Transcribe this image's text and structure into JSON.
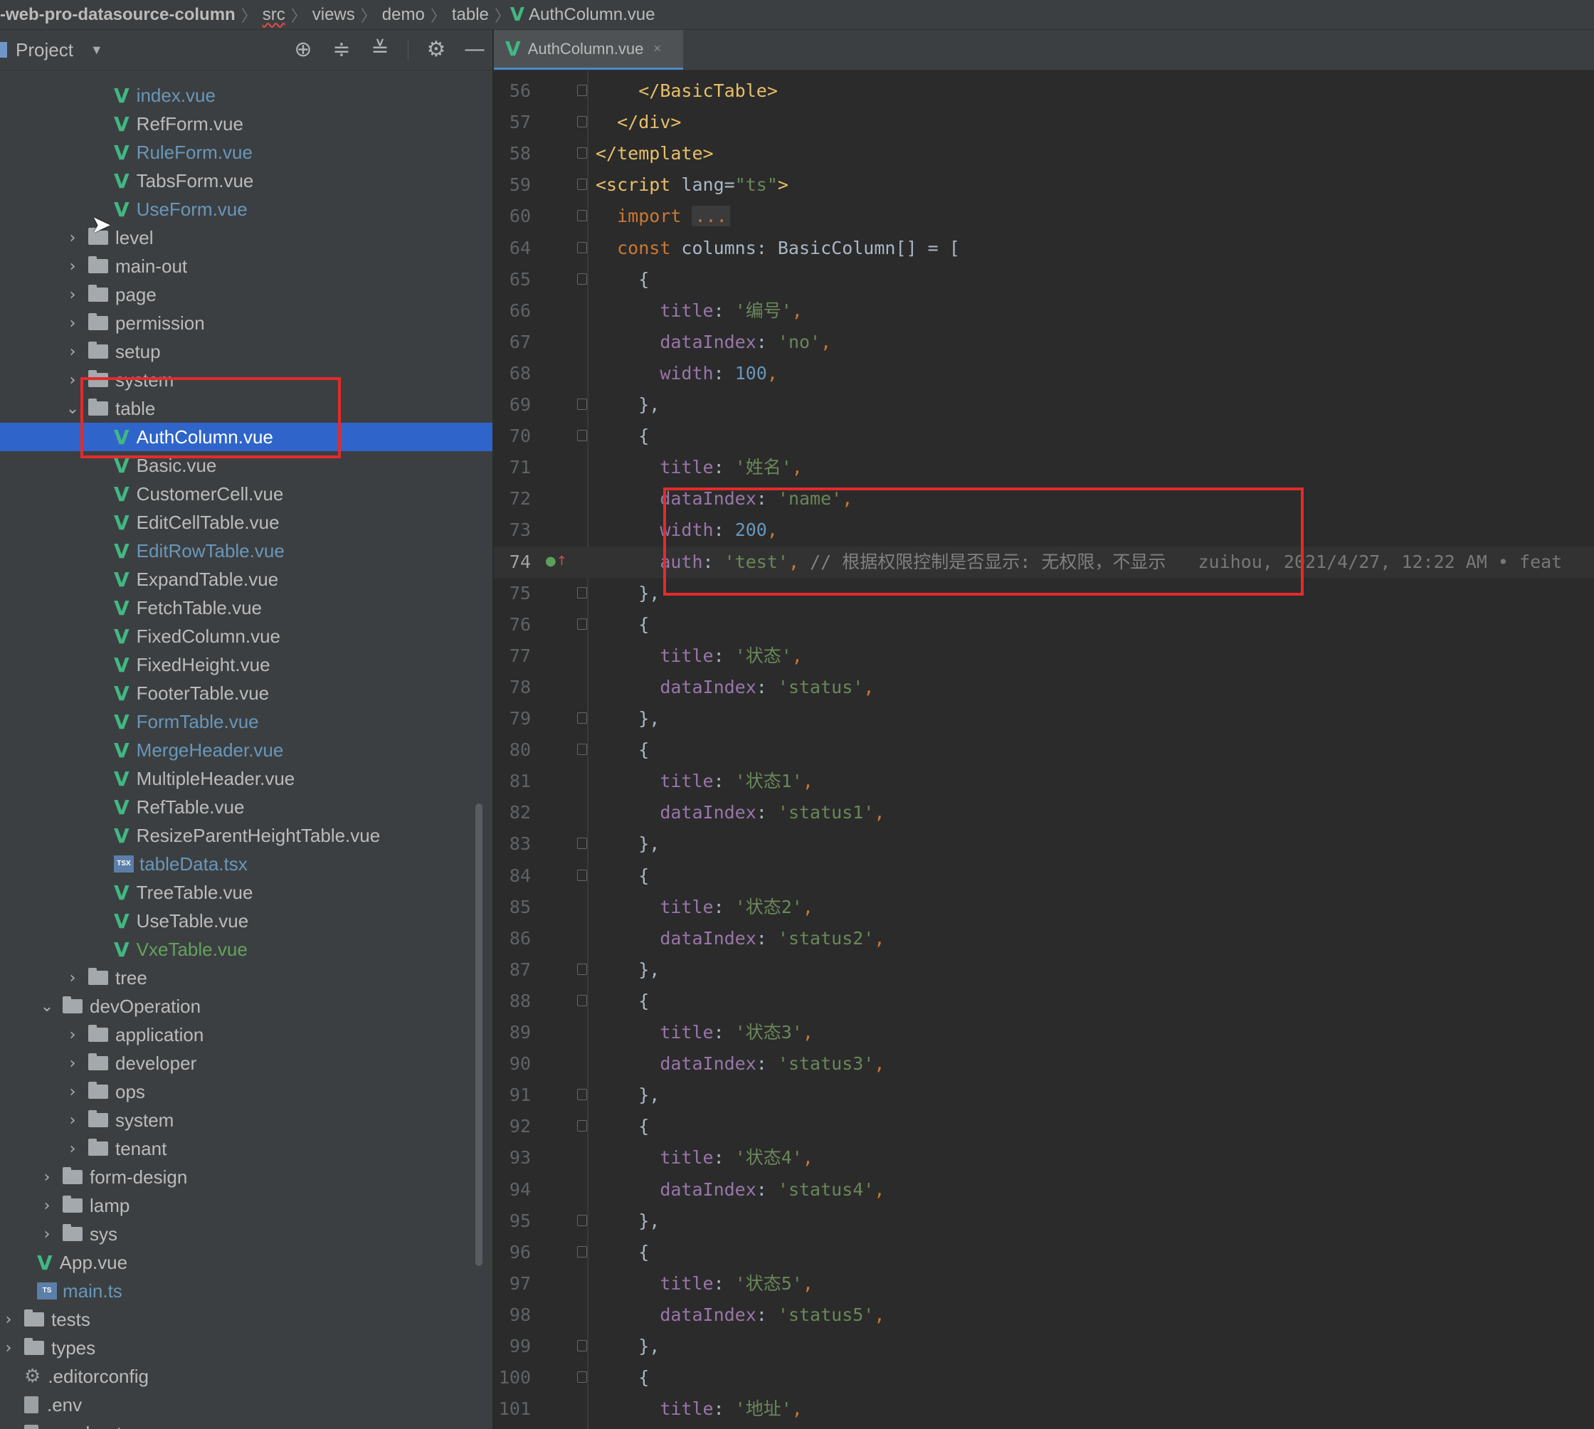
{
  "breadcrumb": {
    "items": [
      "-web-pro-datasource-column",
      "src",
      "views",
      "demo",
      "table",
      "AuthColumn.vue"
    ]
  },
  "project_panel": {
    "title": "Project",
    "icons": [
      "locate-icon",
      "expand-all-icon",
      "collapse-all-icon",
      "gear-icon",
      "minimize-icon"
    ]
  },
  "tree": [
    {
      "label": "index.vue",
      "type": "vue",
      "color": "blue",
      "indent": 6
    },
    {
      "label": "RefForm.vue",
      "type": "vue",
      "color": "default",
      "indent": 6
    },
    {
      "label": "RuleForm.vue",
      "type": "vue",
      "color": "blue",
      "indent": 6
    },
    {
      "label": "TabsForm.vue",
      "type": "vue",
      "color": "default",
      "indent": 6
    },
    {
      "label": "UseForm.vue",
      "type": "vue",
      "color": "blue",
      "indent": 6
    },
    {
      "label": "level",
      "type": "folder",
      "state": "collapsed",
      "indent": 5
    },
    {
      "label": "main-out",
      "type": "folder",
      "state": "collapsed",
      "indent": 5
    },
    {
      "label": "page",
      "type": "folder",
      "state": "collapsed",
      "indent": 5
    },
    {
      "label": "permission",
      "type": "folder",
      "state": "collapsed",
      "indent": 5
    },
    {
      "label": "setup",
      "type": "folder",
      "state": "collapsed",
      "indent": 5
    },
    {
      "label": "system",
      "type": "folder",
      "state": "collapsed",
      "indent": 5
    },
    {
      "label": "table",
      "type": "folder",
      "state": "expanded",
      "indent": 5
    },
    {
      "label": "AuthColumn.vue",
      "type": "vue",
      "color": "white",
      "indent": 6,
      "selected": true
    },
    {
      "label": "Basic.vue",
      "type": "vue",
      "color": "default",
      "indent": 6
    },
    {
      "label": "CustomerCell.vue",
      "type": "vue",
      "color": "default",
      "indent": 6
    },
    {
      "label": "EditCellTable.vue",
      "type": "vue",
      "color": "default",
      "indent": 6
    },
    {
      "label": "EditRowTable.vue",
      "type": "vue",
      "color": "blue",
      "indent": 6
    },
    {
      "label": "ExpandTable.vue",
      "type": "vue",
      "color": "default",
      "indent": 6
    },
    {
      "label": "FetchTable.vue",
      "type": "vue",
      "color": "default",
      "indent": 6
    },
    {
      "label": "FixedColumn.vue",
      "type": "vue",
      "color": "default",
      "indent": 6
    },
    {
      "label": "FixedHeight.vue",
      "type": "vue",
      "color": "default",
      "indent": 6
    },
    {
      "label": "FooterTable.vue",
      "type": "vue",
      "color": "default",
      "indent": 6
    },
    {
      "label": "FormTable.vue",
      "type": "vue",
      "color": "blue",
      "indent": 6
    },
    {
      "label": "MergeHeader.vue",
      "type": "vue",
      "color": "blue",
      "indent": 6
    },
    {
      "label": "MultipleHeader.vue",
      "type": "vue",
      "color": "default",
      "indent": 6
    },
    {
      "label": "RefTable.vue",
      "type": "vue",
      "color": "default",
      "indent": 6
    },
    {
      "label": "ResizeParentHeightTable.vue",
      "type": "vue",
      "color": "default",
      "indent": 6
    },
    {
      "label": "tableData.tsx",
      "type": "tsx",
      "color": "blue",
      "indent": 6
    },
    {
      "label": "TreeTable.vue",
      "type": "vue",
      "color": "default",
      "indent": 6
    },
    {
      "label": "UseTable.vue",
      "type": "vue",
      "color": "default",
      "indent": 6
    },
    {
      "label": "VxeTable.vue",
      "type": "vue",
      "color": "green",
      "indent": 6
    },
    {
      "label": "tree",
      "type": "folder",
      "state": "collapsed",
      "indent": 5
    },
    {
      "label": "devOperation",
      "type": "folder",
      "state": "expanded",
      "indent": 4
    },
    {
      "label": "application",
      "type": "folder",
      "state": "collapsed",
      "indent": 5
    },
    {
      "label": "developer",
      "type": "folder",
      "state": "collapsed",
      "indent": 5
    },
    {
      "label": "ops",
      "type": "folder",
      "state": "collapsed",
      "indent": 5
    },
    {
      "label": "system",
      "type": "folder",
      "state": "collapsed",
      "indent": 5
    },
    {
      "label": "tenant",
      "type": "folder",
      "state": "collapsed",
      "indent": 5
    },
    {
      "label": "form-design",
      "type": "folder",
      "state": "collapsed",
      "indent": 4
    },
    {
      "label": "lamp",
      "type": "folder",
      "state": "collapsed",
      "indent": 4
    },
    {
      "label": "sys",
      "type": "folder",
      "state": "collapsed",
      "indent": 4
    },
    {
      "label": "App.vue",
      "type": "vue",
      "color": "default",
      "indent": 3
    },
    {
      "label": "main.ts",
      "type": "ts",
      "color": "blue",
      "indent": 3
    },
    {
      "label": "tests",
      "type": "folder",
      "state": "collapsed",
      "indent": 1
    },
    {
      "label": "types",
      "type": "folder",
      "state": "collapsed",
      "indent": 1
    },
    {
      "label": ".editorconfig",
      "type": "config",
      "color": "default",
      "indent": 2
    },
    {
      "label": ".env",
      "type": "file",
      "color": "default",
      "indent": 2
    },
    {
      "label": ".env.boot",
      "type": "file",
      "color": "default",
      "indent": 2
    }
  ],
  "editor_tab": {
    "label": "AuthColumn.vue",
    "close": "×"
  },
  "code": {
    "current_line": 74,
    "lines": [
      {
        "n": 56,
        "fold": true,
        "segs": [
          [
            "    ",
            "ident"
          ],
          [
            "</",
            "tag"
          ],
          [
            "BasicTable",
            "tag"
          ],
          [
            ">",
            "tag"
          ]
        ]
      },
      {
        "n": 57,
        "fold": true,
        "segs": [
          [
            "  ",
            "ident"
          ],
          [
            "</div>",
            "tag"
          ]
        ]
      },
      {
        "n": 58,
        "fold": true,
        "segs": [
          [
            "</template>",
            "tag"
          ]
        ]
      },
      {
        "n": 59,
        "fold": true,
        "segs": [
          [
            "<script ",
            "tag"
          ],
          [
            "lang=",
            "ident"
          ],
          [
            "\"ts\"",
            "str"
          ],
          [
            ">",
            "tag"
          ]
        ]
      },
      {
        "n": 60,
        "fold": true,
        "segs": [
          [
            "  ",
            "ident"
          ],
          [
            "import ",
            "kw"
          ],
          [
            "...",
            "fold-text"
          ]
        ]
      },
      {
        "n": 64,
        "fold": true,
        "segs": [
          [
            "  ",
            "ident"
          ],
          [
            "const ",
            "kw"
          ],
          [
            "columns: BasicColumn[] = [",
            "ident"
          ]
        ]
      },
      {
        "n": 65,
        "fold": true,
        "segs": [
          [
            "    {",
            "ident"
          ]
        ]
      },
      {
        "n": 66,
        "fold": false,
        "segs": [
          [
            "      ",
            "ident"
          ],
          [
            "title",
            "prop"
          ],
          [
            ": ",
            "ident"
          ],
          [
            "'编号'",
            "str"
          ],
          [
            ",",
            "kw"
          ]
        ]
      },
      {
        "n": 67,
        "fold": false,
        "segs": [
          [
            "      ",
            "ident"
          ],
          [
            "dataIndex",
            "prop"
          ],
          [
            ": ",
            "ident"
          ],
          [
            "'no'",
            "str"
          ],
          [
            ",",
            "kw"
          ]
        ]
      },
      {
        "n": 68,
        "fold": false,
        "segs": [
          [
            "      ",
            "ident"
          ],
          [
            "width",
            "prop"
          ],
          [
            ": ",
            "ident"
          ],
          [
            "100",
            "num"
          ],
          [
            ",",
            "kw"
          ]
        ]
      },
      {
        "n": 69,
        "fold": true,
        "segs": [
          [
            "    },",
            "ident"
          ]
        ]
      },
      {
        "n": 70,
        "fold": true,
        "segs": [
          [
            "    {",
            "ident"
          ]
        ]
      },
      {
        "n": 71,
        "fold": false,
        "segs": [
          [
            "      ",
            "ident"
          ],
          [
            "title",
            "prop"
          ],
          [
            ": ",
            "ident"
          ],
          [
            "'姓名'",
            "str"
          ],
          [
            ",",
            "kw"
          ]
        ]
      },
      {
        "n": 72,
        "fold": false,
        "segs": [
          [
            "      ",
            "ident"
          ],
          [
            "dataIndex",
            "prop"
          ],
          [
            ": ",
            "ident"
          ],
          [
            "'name'",
            "str"
          ],
          [
            ",",
            "kw"
          ]
        ]
      },
      {
        "n": 73,
        "fold": false,
        "segs": [
          [
            "      ",
            "ident"
          ],
          [
            "width",
            "prop"
          ],
          [
            ": ",
            "ident"
          ],
          [
            "200",
            "num"
          ],
          [
            ",",
            "kw"
          ]
        ]
      },
      {
        "n": 74,
        "fold": false,
        "segs": [
          [
            "      ",
            "ident"
          ],
          [
            "auth",
            "prop"
          ],
          [
            ": ",
            "ident"
          ],
          [
            "'test'",
            "str"
          ],
          [
            ", ",
            "kw"
          ],
          [
            "// 根据权限控制是否显示: 无权限，不显示",
            "cmt"
          ],
          [
            "   zuihou, 2021/4/27, 12:22 AM • feat",
            "blame"
          ]
        ]
      },
      {
        "n": 75,
        "fold": true,
        "segs": [
          [
            "    },",
            "ident"
          ]
        ]
      },
      {
        "n": 76,
        "fold": true,
        "segs": [
          [
            "    {",
            "ident"
          ]
        ]
      },
      {
        "n": 77,
        "fold": false,
        "segs": [
          [
            "      ",
            "ident"
          ],
          [
            "title",
            "prop"
          ],
          [
            ": ",
            "ident"
          ],
          [
            "'状态'",
            "str"
          ],
          [
            ",",
            "kw"
          ]
        ]
      },
      {
        "n": 78,
        "fold": false,
        "segs": [
          [
            "      ",
            "ident"
          ],
          [
            "dataIndex",
            "prop"
          ],
          [
            ": ",
            "ident"
          ],
          [
            "'status'",
            "str"
          ],
          [
            ",",
            "kw"
          ]
        ]
      },
      {
        "n": 79,
        "fold": true,
        "segs": [
          [
            "    },",
            "ident"
          ]
        ]
      },
      {
        "n": 80,
        "fold": true,
        "segs": [
          [
            "    {",
            "ident"
          ]
        ]
      },
      {
        "n": 81,
        "fold": false,
        "segs": [
          [
            "      ",
            "ident"
          ],
          [
            "title",
            "prop"
          ],
          [
            ": ",
            "ident"
          ],
          [
            "'状态1'",
            "str"
          ],
          [
            ",",
            "kw"
          ]
        ]
      },
      {
        "n": 82,
        "fold": false,
        "segs": [
          [
            "      ",
            "ident"
          ],
          [
            "dataIndex",
            "prop"
          ],
          [
            ": ",
            "ident"
          ],
          [
            "'status1'",
            "str"
          ],
          [
            ",",
            "kw"
          ]
        ]
      },
      {
        "n": 83,
        "fold": true,
        "segs": [
          [
            "    },",
            "ident"
          ]
        ]
      },
      {
        "n": 84,
        "fold": true,
        "segs": [
          [
            "    {",
            "ident"
          ]
        ]
      },
      {
        "n": 85,
        "fold": false,
        "segs": [
          [
            "      ",
            "ident"
          ],
          [
            "title",
            "prop"
          ],
          [
            ": ",
            "ident"
          ],
          [
            "'状态2'",
            "str"
          ],
          [
            ",",
            "kw"
          ]
        ]
      },
      {
        "n": 86,
        "fold": false,
        "segs": [
          [
            "      ",
            "ident"
          ],
          [
            "dataIndex",
            "prop"
          ],
          [
            ": ",
            "ident"
          ],
          [
            "'status2'",
            "str"
          ],
          [
            ",",
            "kw"
          ]
        ]
      },
      {
        "n": 87,
        "fold": true,
        "segs": [
          [
            "    },",
            "ident"
          ]
        ]
      },
      {
        "n": 88,
        "fold": true,
        "segs": [
          [
            "    {",
            "ident"
          ]
        ]
      },
      {
        "n": 89,
        "fold": false,
        "segs": [
          [
            "      ",
            "ident"
          ],
          [
            "title",
            "prop"
          ],
          [
            ": ",
            "ident"
          ],
          [
            "'状态3'",
            "str"
          ],
          [
            ",",
            "kw"
          ]
        ]
      },
      {
        "n": 90,
        "fold": false,
        "segs": [
          [
            "      ",
            "ident"
          ],
          [
            "dataIndex",
            "prop"
          ],
          [
            ": ",
            "ident"
          ],
          [
            "'status3'",
            "str"
          ],
          [
            ",",
            "kw"
          ]
        ]
      },
      {
        "n": 91,
        "fold": true,
        "segs": [
          [
            "    },",
            "ident"
          ]
        ]
      },
      {
        "n": 92,
        "fold": true,
        "segs": [
          [
            "    {",
            "ident"
          ]
        ]
      },
      {
        "n": 93,
        "fold": false,
        "segs": [
          [
            "      ",
            "ident"
          ],
          [
            "title",
            "prop"
          ],
          [
            ": ",
            "ident"
          ],
          [
            "'状态4'",
            "str"
          ],
          [
            ",",
            "kw"
          ]
        ]
      },
      {
        "n": 94,
        "fold": false,
        "segs": [
          [
            "      ",
            "ident"
          ],
          [
            "dataIndex",
            "prop"
          ],
          [
            ": ",
            "ident"
          ],
          [
            "'status4'",
            "str"
          ],
          [
            ",",
            "kw"
          ]
        ]
      },
      {
        "n": 95,
        "fold": true,
        "segs": [
          [
            "    },",
            "ident"
          ]
        ]
      },
      {
        "n": 96,
        "fold": true,
        "segs": [
          [
            "    {",
            "ident"
          ]
        ]
      },
      {
        "n": 97,
        "fold": false,
        "segs": [
          [
            "      ",
            "ident"
          ],
          [
            "title",
            "prop"
          ],
          [
            ": ",
            "ident"
          ],
          [
            "'状态5'",
            "str"
          ],
          [
            ",",
            "kw"
          ]
        ]
      },
      {
        "n": 98,
        "fold": false,
        "segs": [
          [
            "      ",
            "ident"
          ],
          [
            "dataIndex",
            "prop"
          ],
          [
            ": ",
            "ident"
          ],
          [
            "'status5'",
            "str"
          ],
          [
            ",",
            "kw"
          ]
        ]
      },
      {
        "n": 99,
        "fold": true,
        "segs": [
          [
            "    },",
            "ident"
          ]
        ]
      },
      {
        "n": 100,
        "fold": true,
        "segs": [
          [
            "    {",
            "ident"
          ]
        ]
      },
      {
        "n": 101,
        "fold": false,
        "segs": [
          [
            "      ",
            "ident"
          ],
          [
            "title",
            "prop"
          ],
          [
            ": ",
            "ident"
          ],
          [
            "'地址'",
            "str"
          ],
          [
            ",",
            "kw"
          ]
        ]
      }
    ]
  },
  "colors": {
    "selection": "#2f65ca",
    "highlight_box": "#e32b2b",
    "vue_icon": "#41b883"
  }
}
